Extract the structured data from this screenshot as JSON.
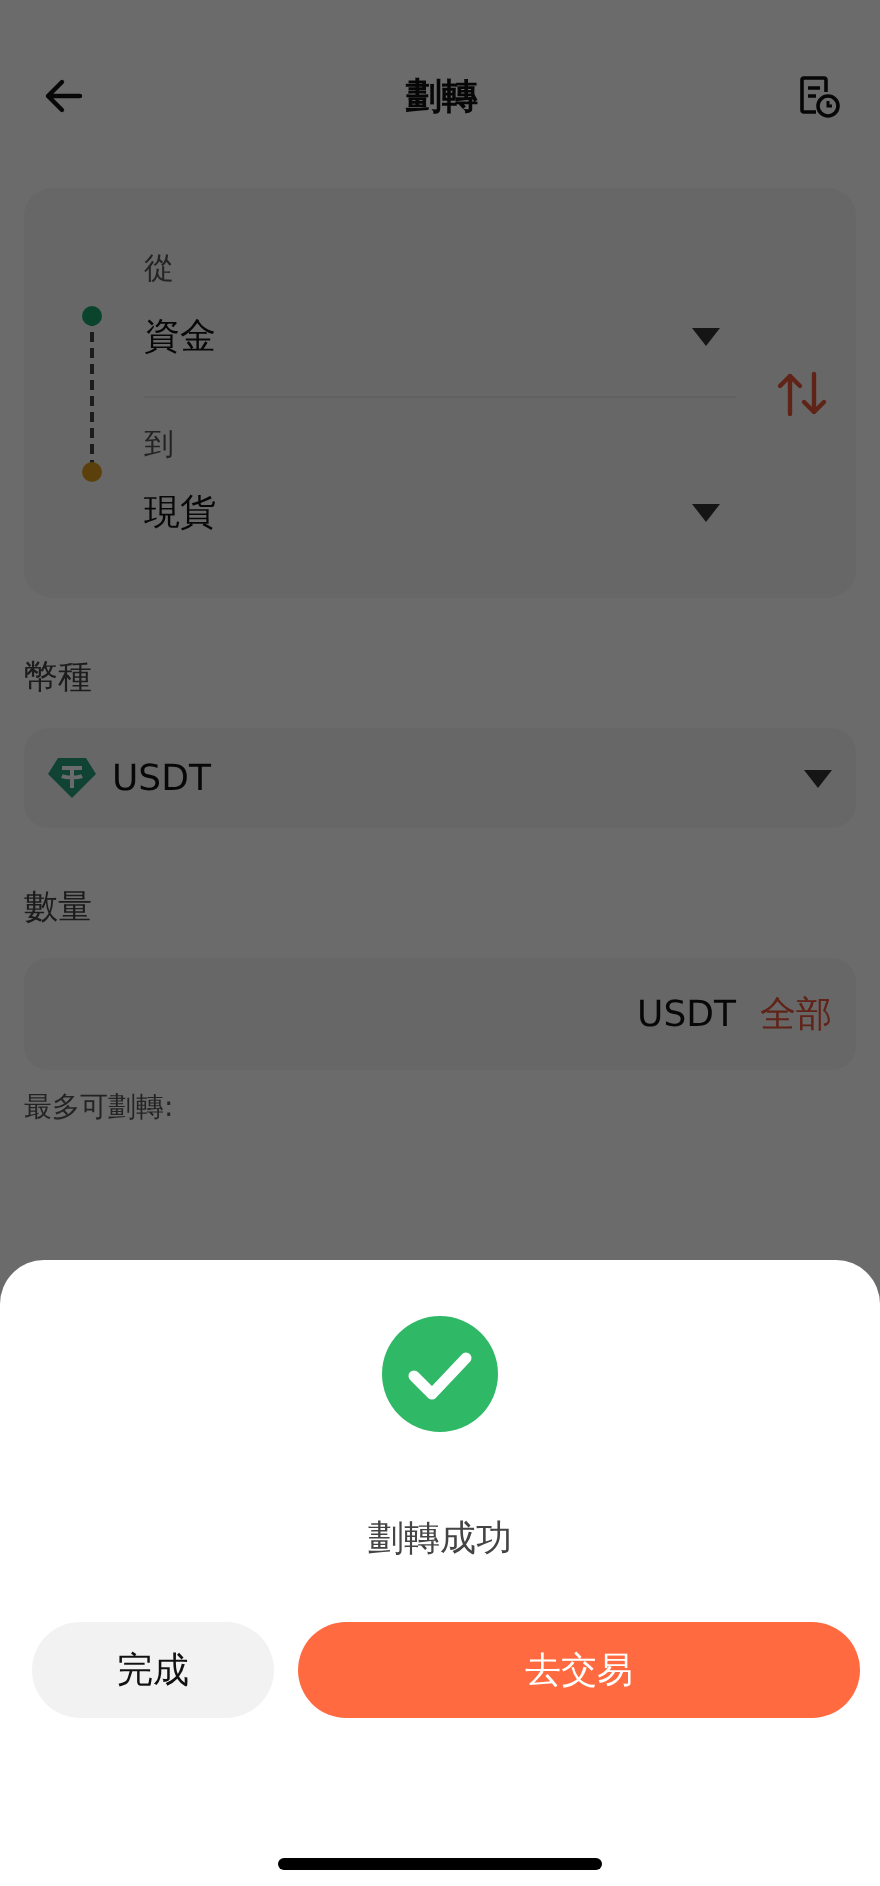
{
  "header": {
    "title": "劃轉"
  },
  "transfer": {
    "from_label": "從",
    "from_value": "資金",
    "to_label": "到",
    "to_value": "現貨"
  },
  "currency": {
    "label": "幣種",
    "value": "USDT"
  },
  "amount": {
    "label": "數量",
    "unit": "USDT",
    "all_button": "全部",
    "max_label": "最多可劃轉:"
  },
  "dialog": {
    "message": "劃轉成功",
    "buttons": [
      {
        "label": "完成",
        "kind": "secondary"
      },
      {
        "label": "去交易",
        "kind": "primary"
      }
    ]
  }
}
